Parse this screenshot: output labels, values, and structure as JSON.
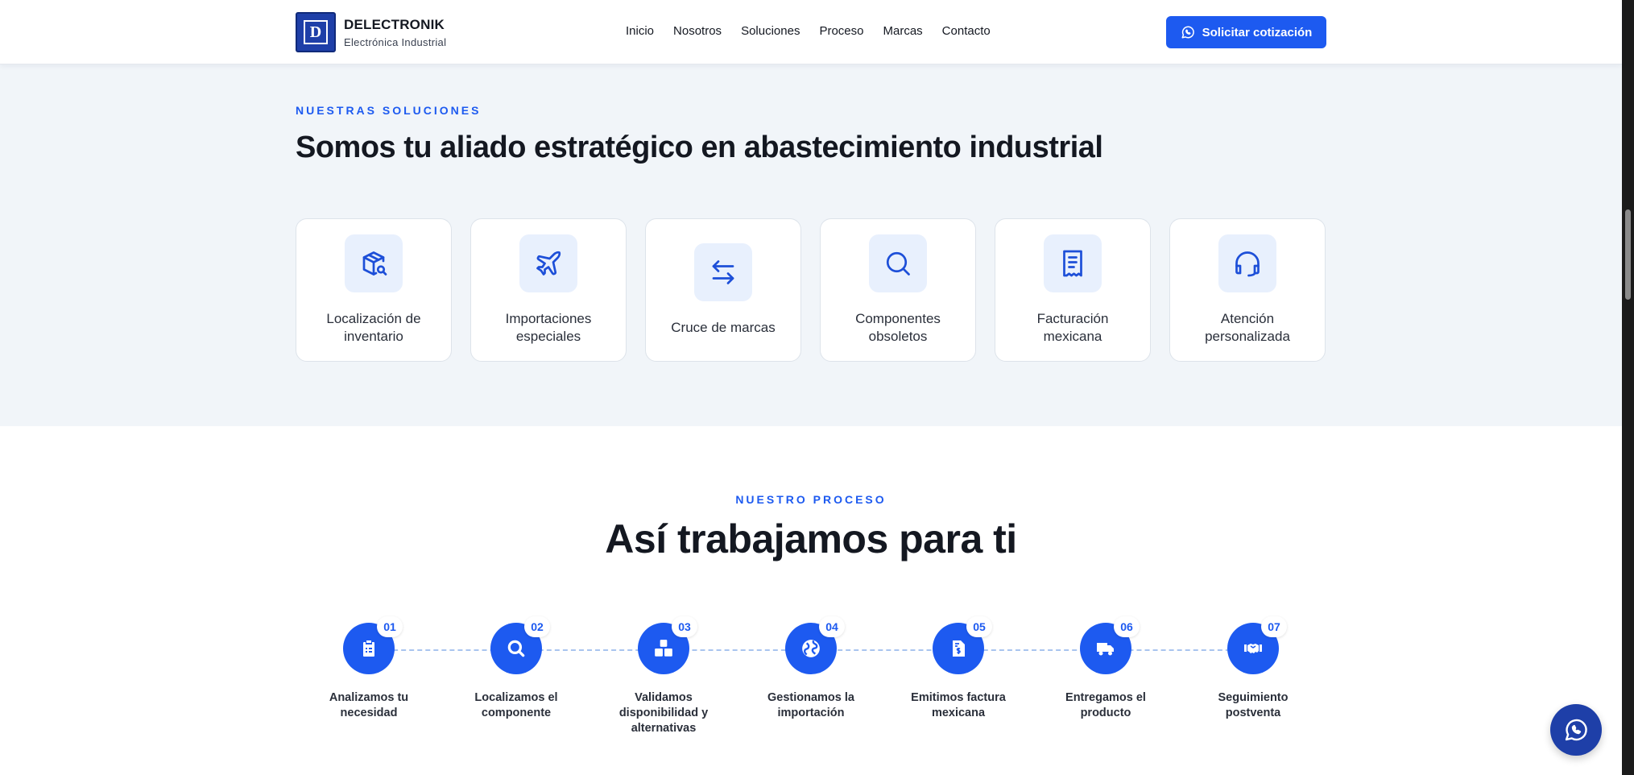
{
  "header": {
    "brand_name": "DELECTRONIK",
    "brand_sub": "Electrónica Industrial",
    "nav": [
      "Inicio",
      "Nosotros",
      "Soluciones",
      "Proceso",
      "Marcas",
      "Contacto"
    ],
    "cta_label": "Solicitar cotización"
  },
  "solutions": {
    "eyebrow": "NUESTRAS SOLUCIONES",
    "title": "Somos tu aliado estratégico en abastecimiento industrial",
    "cards": [
      {
        "icon": "package-search-icon",
        "label": "Localización de inventario"
      },
      {
        "icon": "plane-icon",
        "label": "Importaciones especiales"
      },
      {
        "icon": "arrows-swap-icon",
        "label": "Cruce de marcas"
      },
      {
        "icon": "search-icon",
        "label": "Componentes obsoletos"
      },
      {
        "icon": "receipt-icon",
        "label": "Facturación mexicana"
      },
      {
        "icon": "headset-icon",
        "label": "Atención personalizada"
      }
    ]
  },
  "process": {
    "eyebrow": "NUESTRO PROCESO",
    "title": "Así trabajamos para ti",
    "steps": [
      {
        "num": "01",
        "icon": "clipboard-icon",
        "label": "Analizamos tu necesidad"
      },
      {
        "num": "02",
        "icon": "search-icon",
        "label": "Localizamos el componente"
      },
      {
        "num": "03",
        "icon": "boxes-icon",
        "label": "Validamos disponibilidad y alternativas"
      },
      {
        "num": "04",
        "icon": "globe-icon",
        "label": "Gestionamos la importación"
      },
      {
        "num": "05",
        "icon": "invoice-icon",
        "label": "Emitimos factura mexicana"
      },
      {
        "num": "06",
        "icon": "truck-icon",
        "label": "Entregamos el producto"
      },
      {
        "num": "07",
        "icon": "handshake-icon",
        "label": "Seguimiento postventa"
      }
    ]
  },
  "colors": {
    "accent": "#1d5af0",
    "logo_bg": "#1e3fa8",
    "section_bg": "#f1f5f9"
  }
}
